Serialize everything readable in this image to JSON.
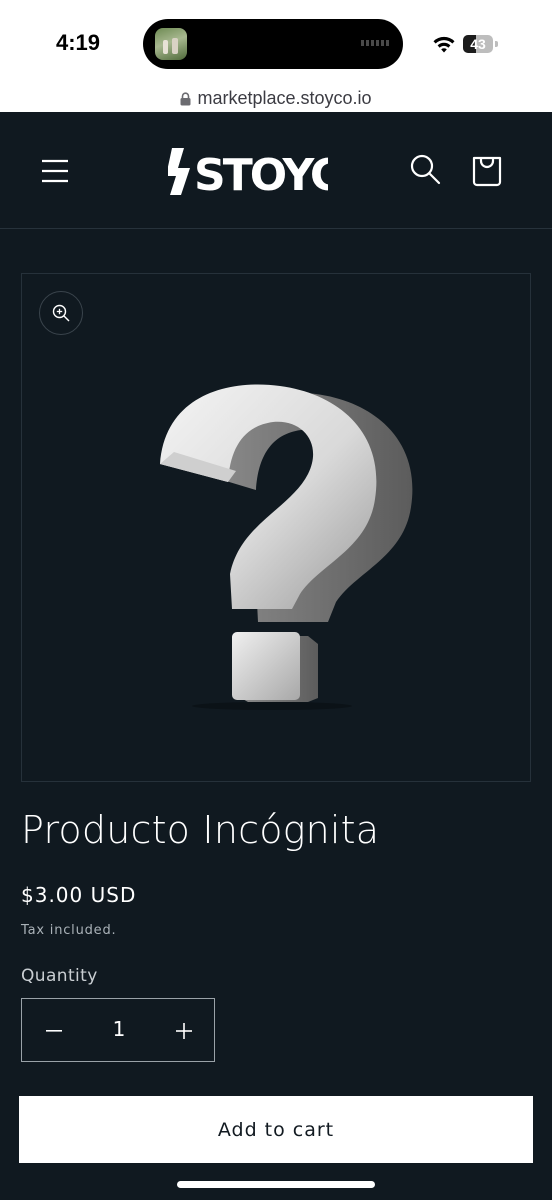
{
  "status_bar": {
    "time": "4:19",
    "battery_level": "43",
    "battery_fraction": 0.43
  },
  "browser": {
    "url": "marketplace.stoyco.io"
  },
  "header": {
    "logo_text": "STOYCO",
    "icons": [
      "menu-icon",
      "search-icon",
      "cart-icon"
    ]
  },
  "product": {
    "media_icon": "zoom-icon",
    "title": "Producto Incógnita",
    "price": "$3.00 USD",
    "tax_note": "Tax included.",
    "quantity_label": "Quantity",
    "quantity_value": "1",
    "add_to_cart_label": "Add to cart"
  },
  "colors": {
    "background": "#101920",
    "button_bg": "#ffffff",
    "button_text": "#121a21",
    "border": "#26313a"
  }
}
